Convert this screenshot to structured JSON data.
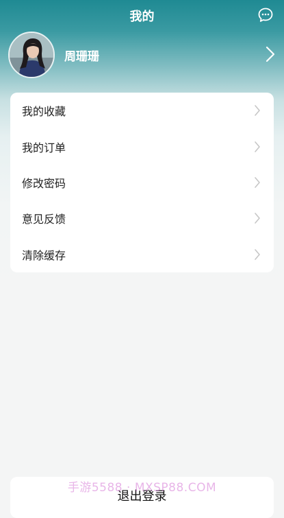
{
  "header": {
    "title": "我的",
    "message_icon": "chat-bubble-icon"
  },
  "profile": {
    "username": "周珊珊",
    "avatar": "user-avatar-photo",
    "chevron_icon": "chevron-right-icon"
  },
  "menu": {
    "items": [
      {
        "label": "我的收藏",
        "icon": "chevron-right-icon"
      },
      {
        "label": "我的订单",
        "icon": "chevron-right-icon"
      },
      {
        "label": "修改密码",
        "icon": "chevron-right-icon"
      },
      {
        "label": "意见反馈",
        "icon": "chevron-right-icon"
      },
      {
        "label": "清除缓存",
        "icon": "chevron-right-icon"
      }
    ]
  },
  "logout": {
    "label": "退出登录"
  },
  "watermark": {
    "text": "手游5588 · MXSP88.COM"
  },
  "colors": {
    "header_top": "#1f8a93",
    "page_background": "#f4f5f5",
    "card_background": "#ffffff",
    "chevron": "#c6c6c6"
  }
}
